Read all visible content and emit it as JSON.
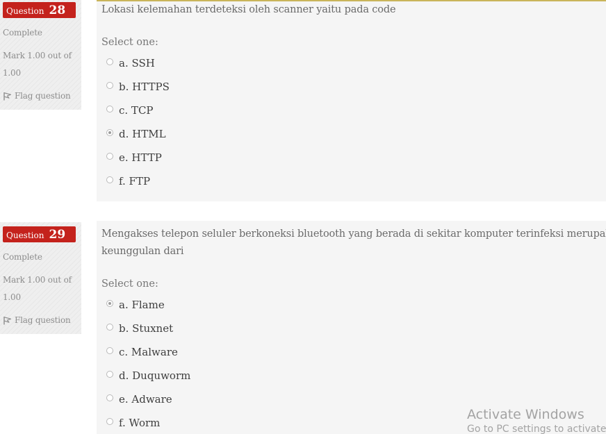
{
  "questions": [
    {
      "label": "Question",
      "number": "28",
      "state": "Complete",
      "grade": "Mark 1.00 out of 1.00",
      "flag_label": "Flag question",
      "text": "Lokasi kelemahan terdeteksi oleh scanner yaitu pada code",
      "prompt": "Select one:",
      "options": [
        "a. SSH",
        "b. HTTPS",
        "c. TCP",
        "d. HTML",
        "e. HTTP",
        "f. FTP"
      ],
      "selected_index": 3
    },
    {
      "label": "Question",
      "number": "29",
      "state": "Complete",
      "grade": "Mark 1.00 out of 1.00",
      "flag_label": "Flag question",
      "text": "Mengakses telepon seluler berkoneksi bluetooth yang berada di sekitar komputer terinfeksi merupakan",
      "text_line2": "keunggulan dari",
      "prompt": "Select one:",
      "options": [
        "a. Flame",
        "b. Stuxnet",
        "c. Malware",
        "d. Duquworm",
        "e. Adware",
        "f. Worm"
      ],
      "selected_index": 0
    }
  ],
  "watermark": {
    "line1": "Activate Windows",
    "line2": "Go to PC settings to activate W"
  },
  "colors": {
    "question_badge": "#c4221c",
    "info_panel": "#efefef",
    "content_panel": "#f5f5f5"
  },
  "icons": {
    "flag": "flag-icon"
  }
}
